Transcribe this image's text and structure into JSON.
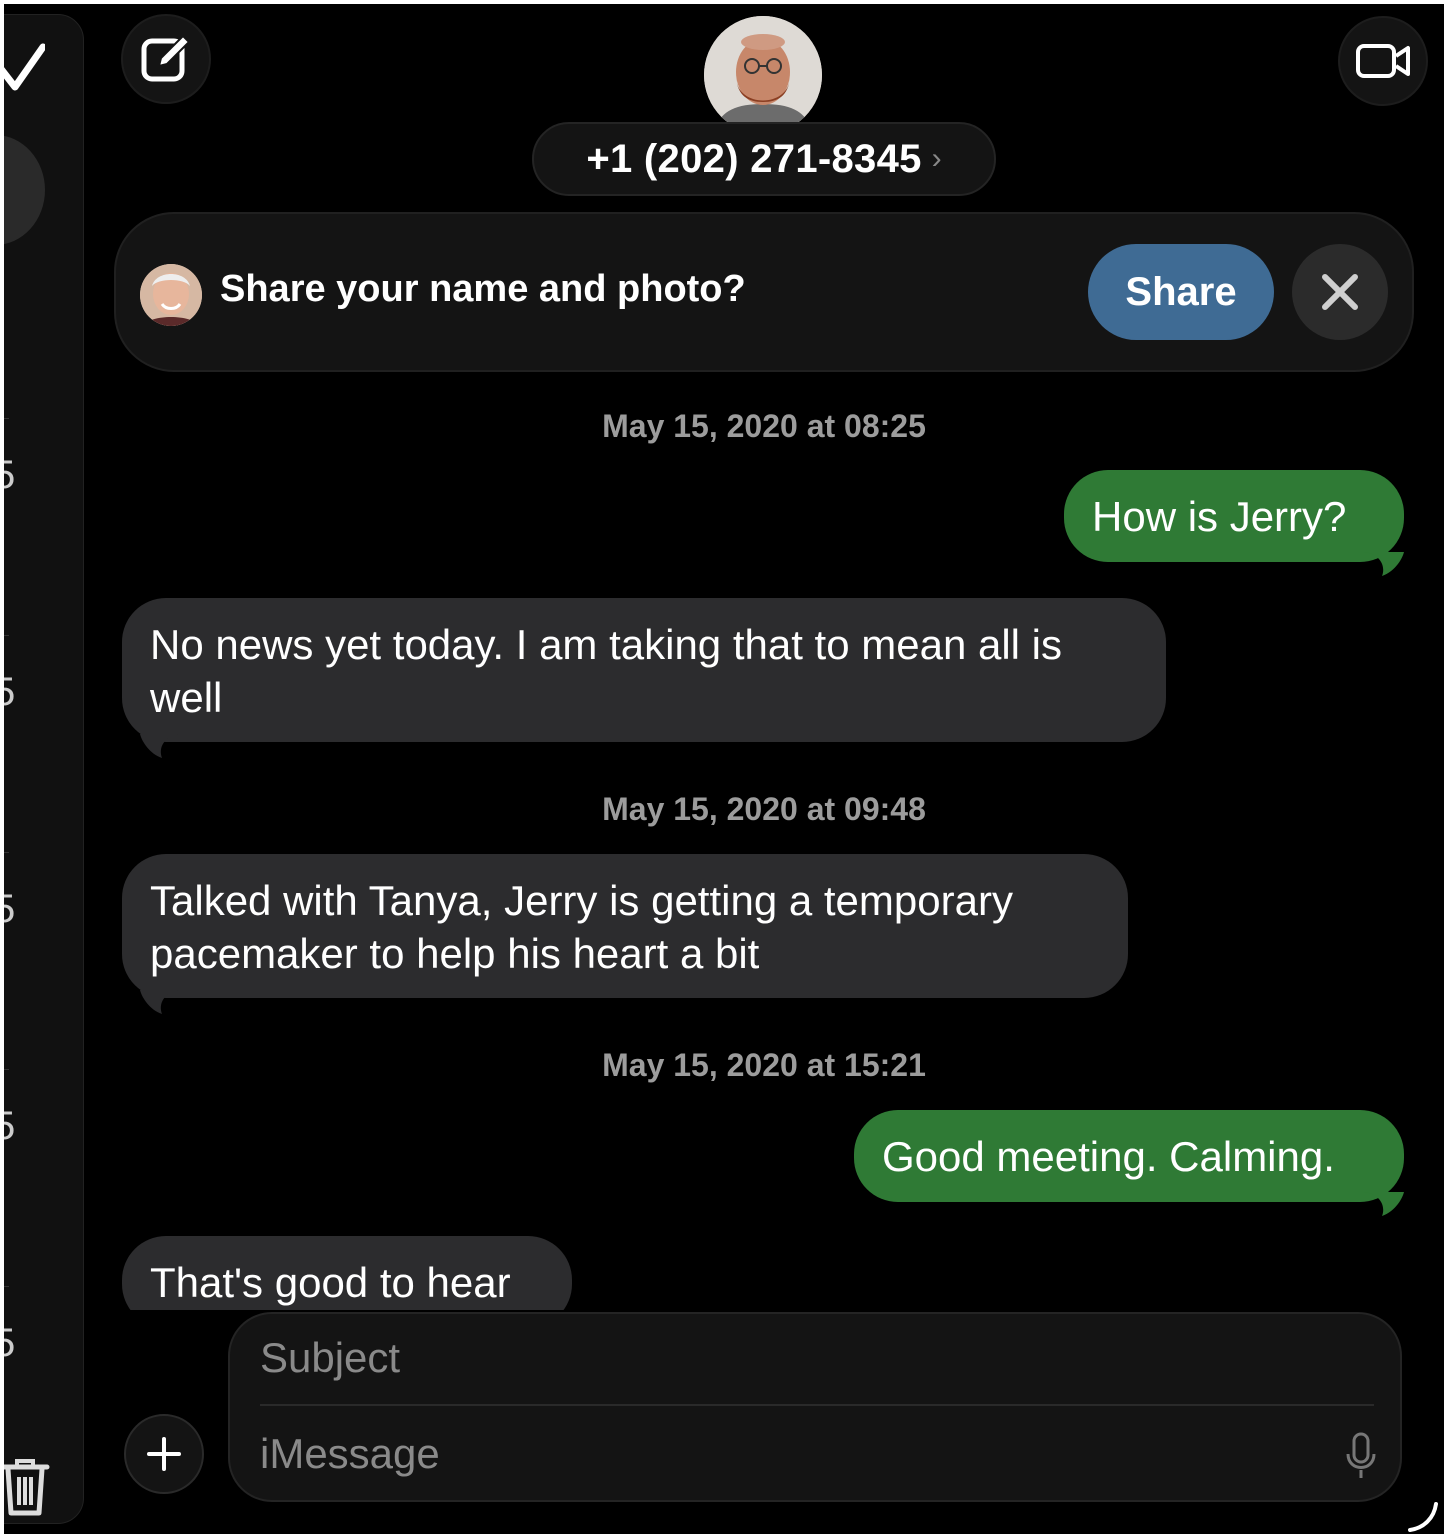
{
  "header": {
    "phone_number": "+1 (202) 271-8345",
    "chevron": "›",
    "compose_icon": "compose-icon",
    "video_icon": "video-camera-icon"
  },
  "share_banner": {
    "prompt": "Share your name and photo?",
    "share_label": "Share",
    "close_icon": "close-icon"
  },
  "sidebar": {
    "digits": [
      "5",
      "5",
      "5",
      "5",
      "5"
    ]
  },
  "messages": [
    {
      "type": "timestamp",
      "text": "May 15, 2020 at 08:25"
    },
    {
      "type": "outgoing",
      "text": "How is Jerry?"
    },
    {
      "type": "incoming",
      "text": "No news yet today. I am taking that to mean all is well"
    },
    {
      "type": "timestamp",
      "text": "May 15, 2020 at 09:48"
    },
    {
      "type": "incoming",
      "text": "Talked with Tanya, Jerry is getting a temporary pacemaker to help his heart a bit"
    },
    {
      "type": "timestamp",
      "text": "May 15, 2020 at 15:21"
    },
    {
      "type": "outgoing",
      "text": "Good meeting. Calming."
    },
    {
      "type": "incoming",
      "text": "That's good to hear"
    }
  ],
  "composer": {
    "subject_placeholder": "Subject",
    "message_placeholder": "iMessage",
    "plus_label": "+"
  },
  "colors": {
    "outgoing_bubble": "#2f7a35",
    "incoming_bubble": "#2c2c2e",
    "share_button": "#3f6b94",
    "background": "#000000"
  }
}
